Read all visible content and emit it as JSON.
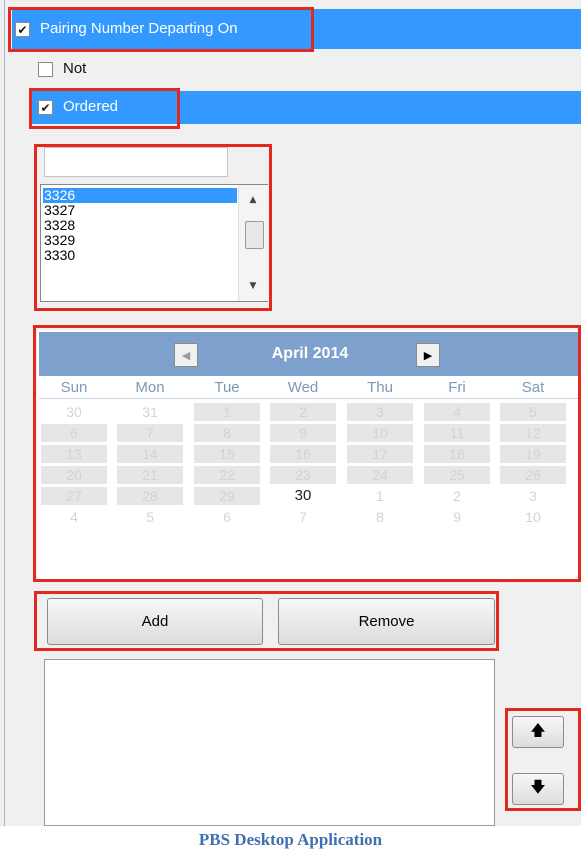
{
  "filters": {
    "pairing": {
      "label": "Pairing Number Departing On",
      "checked": true
    },
    "not": {
      "label": "Not",
      "checked": false
    },
    "ordered": {
      "label": "Ordered",
      "checked": true
    }
  },
  "checkmark_glyph": "✔",
  "search": {
    "value": ""
  },
  "pairing_list": {
    "items": [
      "3326",
      "3327",
      "3328",
      "3329",
      "3330"
    ],
    "selected": "3326",
    "scroll_up_glyph": "▲",
    "scroll_down_glyph": "▼"
  },
  "calendar": {
    "month_label": "April 2014",
    "prev_glyph": "◀",
    "next_glyph": "▶",
    "weekdays": [
      "Sun",
      "Mon",
      "Tue",
      "Wed",
      "Thu",
      "Fri",
      "Sat"
    ],
    "weeks": [
      [
        "30",
        "31",
        "1",
        "2",
        "3",
        "4",
        "5"
      ],
      [
        "6",
        "7",
        "8",
        "9",
        "10",
        "11",
        "12"
      ],
      [
        "13",
        "14",
        "15",
        "16",
        "17",
        "18",
        "19"
      ],
      [
        "20",
        "21",
        "22",
        "23",
        "24",
        "25",
        "26"
      ],
      [
        "27",
        "28",
        "29",
        "30",
        "1",
        "2",
        "3"
      ],
      [
        "4",
        "5",
        "6",
        "7",
        "8",
        "9",
        "10"
      ]
    ],
    "today": "30"
  },
  "buttons": {
    "add": "Add",
    "remove": "Remove"
  },
  "order_buttons": {
    "up_glyph": "🡅",
    "down_glyph": "🡇"
  },
  "caption": "PBS Desktop Application",
  "colors": {
    "highlight": "#3399ff",
    "annotation_red": "#e0291f",
    "calendar_header": "#7ea0cc",
    "caption": "#3f6fb0"
  }
}
